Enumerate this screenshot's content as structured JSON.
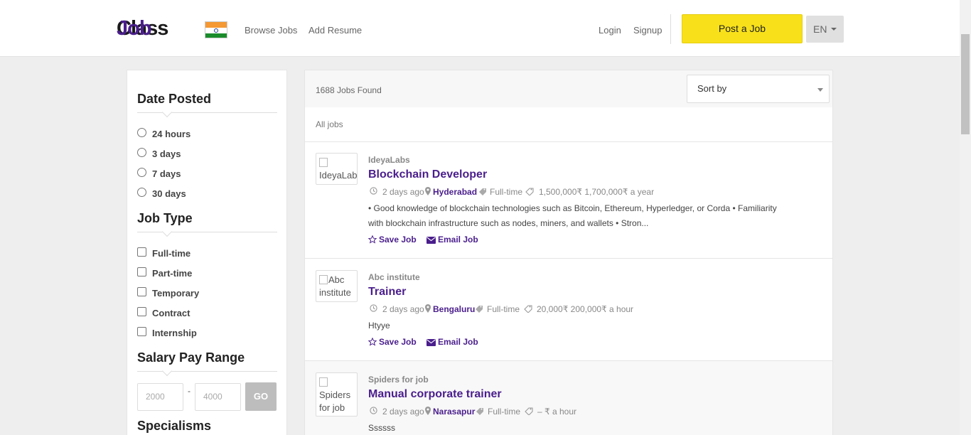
{
  "header": {
    "logo_job": "Job",
    "logo_class": "Class",
    "nav": [
      "Browse Jobs",
      "Add Resume"
    ],
    "login": "Login",
    "signup": "Signup",
    "post_job": "Post a Job",
    "language": "EN"
  },
  "filters": {
    "date_posted": {
      "title": "Date Posted",
      "options": [
        "24 hours",
        "3 days",
        "7 days",
        "30 days"
      ]
    },
    "job_type": {
      "title": "Job Type",
      "options": [
        "Full-time",
        "Part-time",
        "Temporary",
        "Contract",
        "Internship"
      ]
    },
    "salary": {
      "title": "Salary Pay Range",
      "min_placeholder": "2000",
      "max_placeholder": "4000",
      "separator": "-",
      "go": "GO"
    },
    "specialisms": {
      "title": "Specialisms"
    }
  },
  "results": {
    "count": "1688 Jobs Found",
    "sort_label": "Sort by",
    "all_jobs": "All jobs",
    "jobs": [
      {
        "logo_alt": "IdeyaLabs",
        "company": "IdeyaLabs",
        "title": "Blockchain Developer",
        "posted": "2 days ago",
        "location": "Hyderabad",
        "type": "Full-time",
        "salary": "1,500,000₹ 1,700,000₹ a year",
        "description": "• Good knowledge of blockchain technologies such as Bitcoin, Ethereum, Hyperledger, or Corda • Familiarity with blockchain infrastructure such as nodes, miners, and wallets • Stron...",
        "save": "Save Job",
        "email": "Email Job"
      },
      {
        "logo_alt": "Abc institute",
        "company": "Abc institute",
        "title": "Trainer",
        "posted": "2 days ago",
        "location": "Bengaluru",
        "type": "Full-time",
        "salary": "20,000₹ 200,000₹ a hour",
        "description": "Htyye",
        "save": "Save Job",
        "email": "Email Job"
      },
      {
        "logo_alt": "Spiders for job",
        "company": "Spiders for job",
        "title": "Manual corporate trainer",
        "posted": "2 days ago",
        "location": "Narasapur",
        "type": "Full-time",
        "salary": "– ₹ a hour",
        "description": "Ssssss"
      }
    ]
  },
  "colors": {
    "brand_purple": "#4a1e8c",
    "post_button": "#f8e11a",
    "background": "#eeeeee"
  }
}
